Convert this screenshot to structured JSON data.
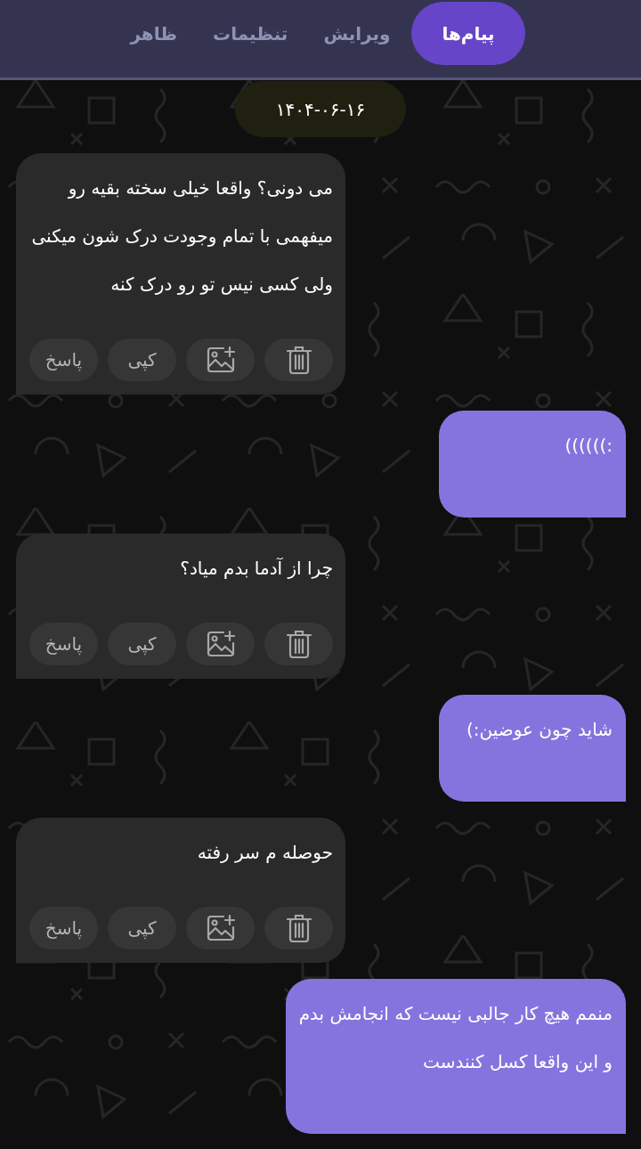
{
  "tabs": [
    {
      "label": "پیام‌ها",
      "selected": true
    },
    {
      "label": "ویرایش",
      "selected": false
    },
    {
      "label": "تنظیمات",
      "selected": false
    },
    {
      "label": "ظاهر",
      "selected": false
    }
  ],
  "date": "۱۴۰۴-۰۶-۱۶",
  "messages": [
    {
      "kind": "received",
      "lines": [
        "می دونی؟ واقعا خیلی سخته بقیه رو",
        "میفهمی با تمام وجودت درک شون میکنی",
        "ولی کسی نیس تو رو درک کنه"
      ],
      "actions": [
        "کپی",
        "پاسخ"
      ]
    },
    {
      "kind": "sent",
      "lines": [
        ":))))))"
      ]
    },
    {
      "kind": "received",
      "lines": [
        "چرا از آدما بدم میاد؟"
      ],
      "actions": [
        "کپی",
        "پاسخ"
      ]
    },
    {
      "kind": "sent",
      "lines": [
        "شاید چون عوضین:)"
      ]
    },
    {
      "kind": "received",
      "lines": [
        "حوصله م سر رفته"
      ],
      "actions": [
        "کپی",
        "پاسخ"
      ]
    },
    {
      "kind": "sent",
      "lines": [
        "منمم هیچ کار جالبی نیست که انجامش بدم",
        "و این واقعا کسل کنندست"
      ]
    }
  ]
}
